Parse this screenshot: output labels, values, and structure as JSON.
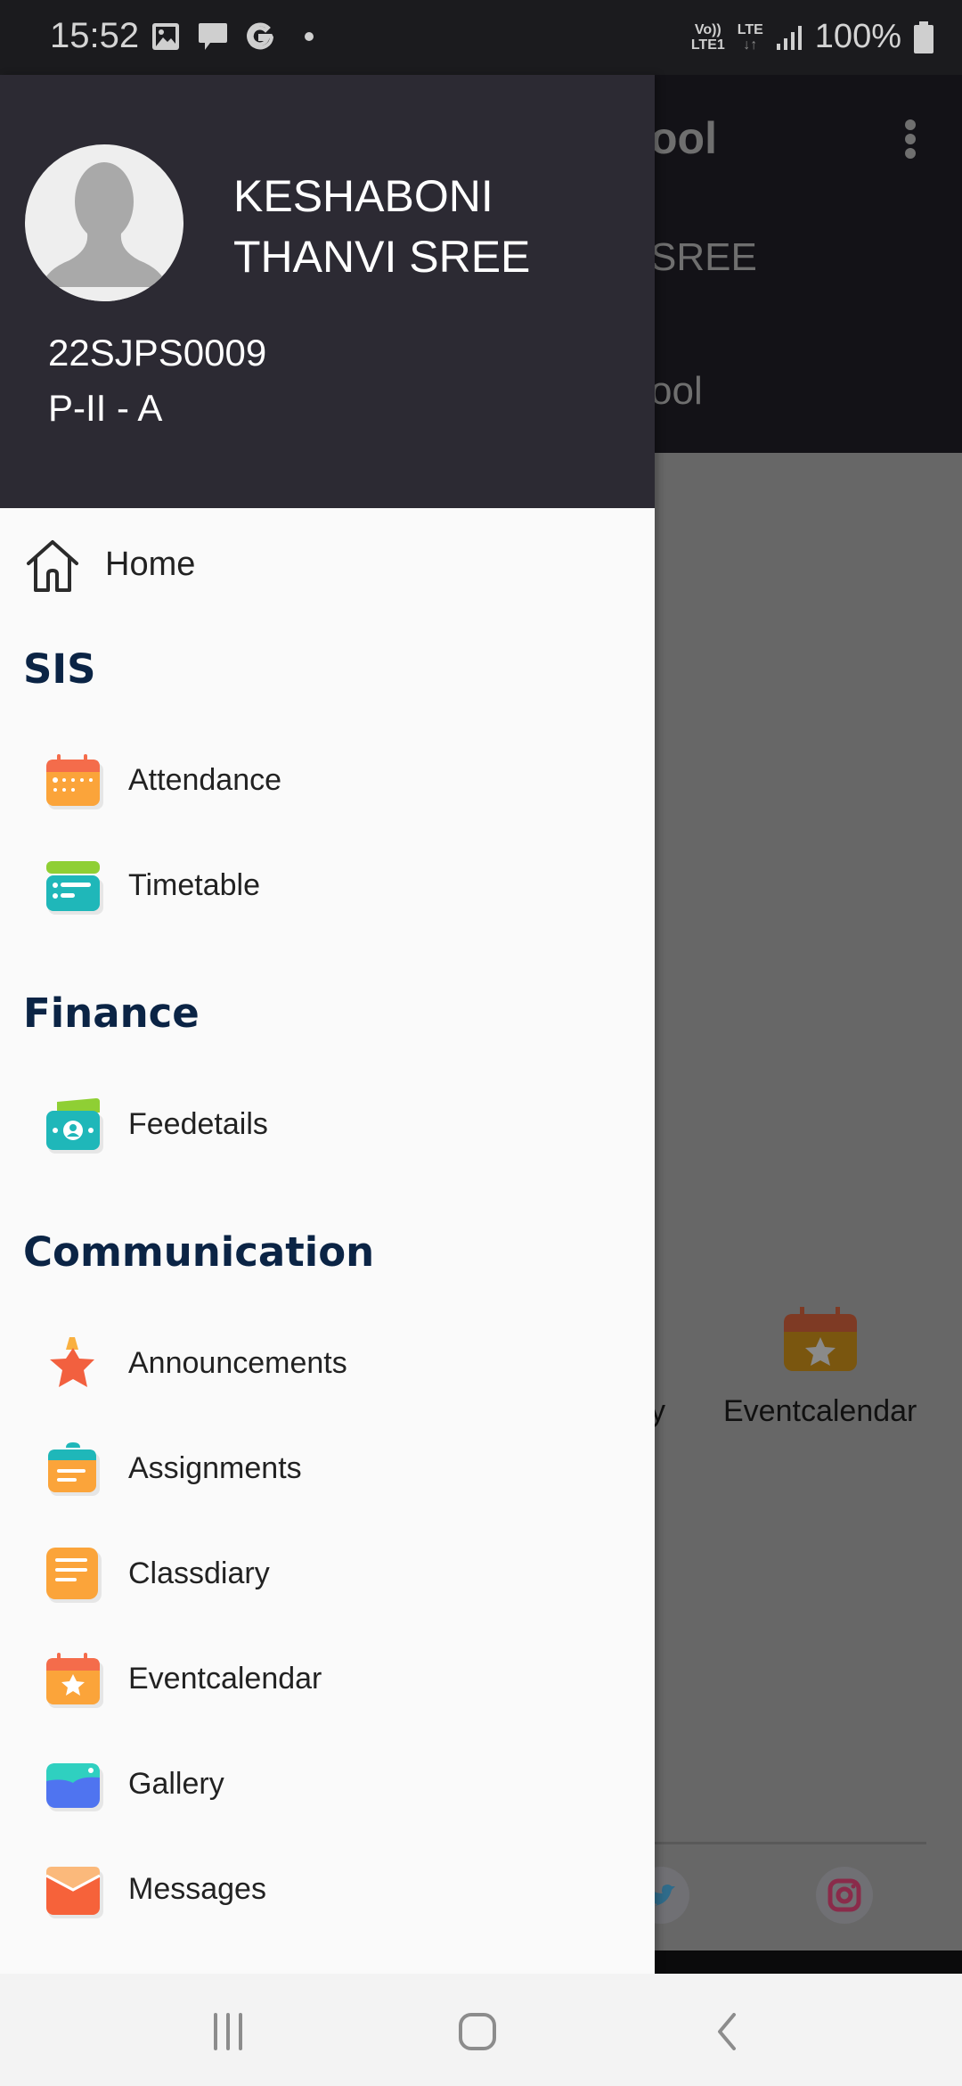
{
  "status_bar": {
    "time": "15:52",
    "left_icons": [
      "image-icon",
      "message-icon",
      "google-icon",
      "dot-icon"
    ],
    "network_top": "Vo))",
    "network_bottom": "LTE1",
    "lte_label": "LTE",
    "battery_percent": "100%"
  },
  "background_app": {
    "title_fragment": "ool",
    "subtitle1_fragment": "SREE",
    "subtitle2_fragment": "ool",
    "tile_label": "Eventcalendar",
    "tile_label_fragment": "y",
    "social": [
      "twitter-icon",
      "instagram-icon"
    ]
  },
  "drawer": {
    "user": {
      "name_line1": "KESHABONI",
      "name_line2": "THANVI SREE",
      "id": "22SJPS0009",
      "class": "P-II - A"
    },
    "home_label": "Home",
    "sections": [
      {
        "title": "SIS",
        "items": [
          {
            "label": "Attendance",
            "icon": "attendance-calendar-icon"
          },
          {
            "label": "Timetable",
            "icon": "timetable-icon"
          }
        ]
      },
      {
        "title": "Finance",
        "items": [
          {
            "label": "Feedetails",
            "icon": "fee-money-icon"
          }
        ]
      },
      {
        "title": "Communication",
        "items": [
          {
            "label": "Announcements",
            "icon": "announcement-star-icon"
          },
          {
            "label": "Assignments",
            "icon": "assignment-clipboard-icon"
          },
          {
            "label": "Classdiary",
            "icon": "classdiary-note-icon"
          },
          {
            "label": "Eventcalendar",
            "icon": "event-calendar-icon"
          },
          {
            "label": "Gallery",
            "icon": "gallery-icon"
          },
          {
            "label": "Messages",
            "icon": "envelope-icon"
          }
        ]
      }
    ]
  },
  "colors": {
    "drawer_header": "#2c2a33",
    "section_title": "#0b2445",
    "drawer_bg": "#fafafa"
  },
  "nav_bar": {
    "buttons": [
      "recents-button",
      "home-button",
      "back-button"
    ]
  }
}
